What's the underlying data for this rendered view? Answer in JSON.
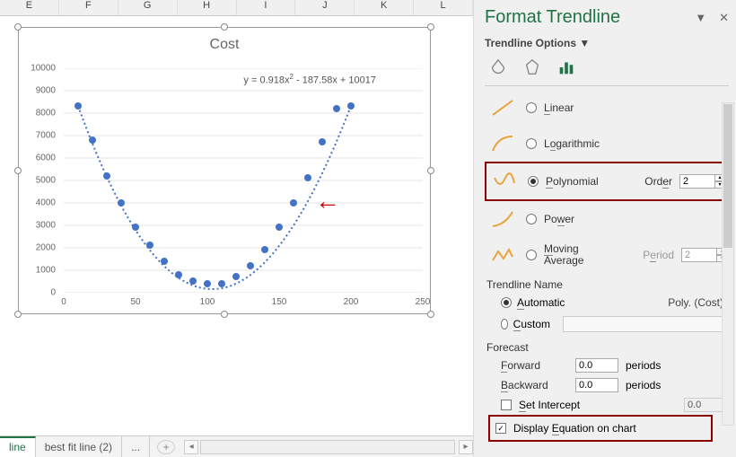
{
  "columns": [
    "E",
    "F",
    "G",
    "H",
    "I",
    "J",
    "K",
    "L"
  ],
  "chart": {
    "title": "Cost",
    "equation_prefix": "y = 0.918x",
    "equation_suffix": " - 187.58x + 10017",
    "yTicks": [
      "0",
      "1000",
      "2000",
      "3000",
      "4000",
      "5000",
      "6000",
      "7000",
      "8000",
      "9000",
      "10000"
    ],
    "xTicks": [
      "0",
      "50",
      "100",
      "150",
      "200",
      "250"
    ]
  },
  "chart_data": {
    "type": "scatter",
    "title": "Cost",
    "xlabel": "",
    "ylabel": "",
    "xlim": [
      0,
      250
    ],
    "ylim": [
      0,
      10000
    ],
    "series": [
      {
        "name": "Cost",
        "x": [
          10,
          20,
          30,
          40,
          50,
          60,
          70,
          80,
          90,
          100,
          110,
          120,
          130,
          140,
          150,
          160,
          170,
          180,
          190,
          200
        ],
        "y": [
          8300,
          6800,
          5200,
          4000,
          2900,
          2100,
          1400,
          800,
          500,
          400,
          400,
          700,
          1200,
          1900,
          2900,
          4000,
          5100,
          6700,
          8200,
          8300
        ]
      }
    ],
    "trendline": {
      "type": "polynomial",
      "order": 2,
      "equation": "y = 0.918x^2 - 187.58x + 10017"
    }
  },
  "tabs": {
    "truncated_left": "line",
    "name": "best fit line (2)",
    "dots": "..."
  },
  "panel": {
    "title": "Format Trendline",
    "subhead": "Trendline Options",
    "opts": {
      "linear": "Linear",
      "log": "Logarithmic",
      "poly": "Polynomial",
      "orderLabel": "Order",
      "orderValue": "2",
      "power": "Power",
      "mavg1": "Moving",
      "mavg2": "Average",
      "periodLabel": "Period",
      "periodValue": "2"
    },
    "nameSection": "Trendline Name",
    "auto": "Automatic",
    "autoVal": "Poly. (Cost)",
    "custom": "Custom",
    "forecast": "Forecast",
    "fwd": "Forward",
    "fwdVal": "0.0",
    "fwdUnit": "periods",
    "bwd": "Backward",
    "bwdVal": "0.0",
    "bwdUnit": "periods",
    "setInt": "Set Intercept",
    "setIntVal": "0.0",
    "dispEq": "Display Equation on chart"
  }
}
